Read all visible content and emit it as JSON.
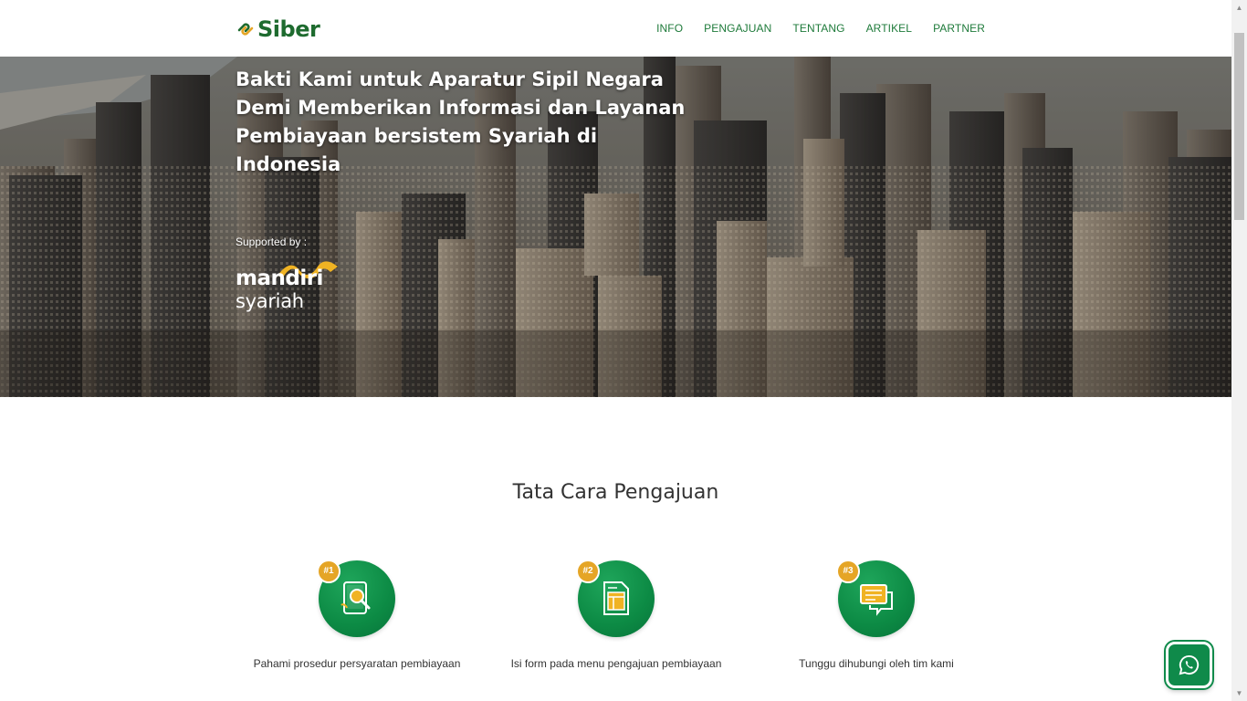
{
  "brand": {
    "name": "Siber",
    "color": "#1e6b2f",
    "icon": "siber-logo-icon"
  },
  "nav": {
    "items": [
      {
        "label": "INFO"
      },
      {
        "label": "PENGAJUAN"
      },
      {
        "label": "TENTANG"
      },
      {
        "label": "ARTIKEL"
      },
      {
        "label": "PARTNER"
      }
    ]
  },
  "hero": {
    "title": "Bakti Kami untuk Aparatur Sipil Negara\nDemi Memberikan Informasi dan Layanan\nPembiayaan bersistem Syariah di Indonesia",
    "supported_by": "Supported by :",
    "partner": {
      "line1": "mandiri",
      "line2": "syariah",
      "icon": "mandiri-syariah-logo",
      "accent": "#f0b323"
    },
    "background": "city-skyline-photo"
  },
  "steps": {
    "title": "Tata Cara Pengajuan",
    "items": [
      {
        "badge": "#1",
        "icon": "search-document-icon",
        "caption": "Pahami prosedur persyaratan pembiayaan"
      },
      {
        "badge": "#2",
        "icon": "form-document-icon",
        "caption": "Isi form pada menu pengajuan pembiayaan"
      },
      {
        "badge": "#3",
        "icon": "chat-bubbles-icon",
        "caption": "Tunggu dihubungi oleh tim kami"
      }
    ],
    "circle_color": "#0c8a44",
    "badge_color": "#e5a526"
  },
  "whatsapp": {
    "icon": "whatsapp-icon",
    "color": "#0f8a4a"
  }
}
